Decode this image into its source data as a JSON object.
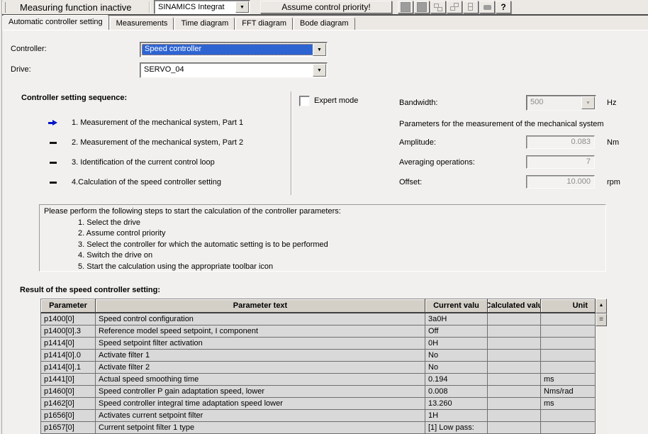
{
  "colors": {
    "highlight_blue": "#2d64d2",
    "arrow_blue": "#0016c8",
    "table_row_bg": "#d9d9d9"
  },
  "toolbar": {
    "status": "Measuring function inactive",
    "device_combo": "SINAMICS Integrat",
    "assume_button": "Assume control priority!",
    "icons": [
      {
        "name": "gray-square-icon"
      },
      {
        "name": "gray-square-icon"
      },
      {
        "name": "step-chain-icon"
      },
      {
        "name": "step-up-icon"
      },
      {
        "name": "step-branch-icon"
      },
      {
        "name": "solid-bar-icon"
      },
      {
        "name": "help-icon",
        "glyph": "?"
      }
    ]
  },
  "tabs": [
    {
      "label": "Automatic controller setting",
      "state": "active"
    },
    {
      "label": "Measurements"
    },
    {
      "label": "Time diagram"
    },
    {
      "label": "FFT diagram"
    },
    {
      "label": "Bode diagram"
    }
  ],
  "form": {
    "controller_label": "Controller:",
    "controller_value": "Speed controller",
    "drive_label": "Drive:",
    "drive_value": "SERVO_04"
  },
  "sequence": {
    "title": "Controller setting sequence:",
    "steps": [
      {
        "marker": "arrow",
        "text": "1. Measurement of the mechanical system, Part 1"
      },
      {
        "marker": "dash",
        "text": "2. Measurement of the mechanical system, Part 2"
      },
      {
        "marker": "dash",
        "text": "3. Identification of the current control loop"
      },
      {
        "marker": "dash",
        "text": "4.Calculation of the speed controller setting"
      }
    ]
  },
  "expert": {
    "checkbox_label": "Expert mode",
    "bandwidth_label": "Bandwidth:",
    "bandwidth_value": "500",
    "bandwidth_unit": "Hz",
    "params_heading": "Parameters for the measurement of the mechanical system",
    "amplitude_label": "Amplitude:",
    "amplitude_value": "0.083",
    "amplitude_unit": "Nm",
    "averaging_label": "Averaging operations:",
    "averaging_value": "7",
    "offset_label": "Offset:",
    "offset_value": "10.000",
    "offset_unit": "rpm"
  },
  "instructions": {
    "intro": "Please perform the following steps to start the calculation of the controller parameters:",
    "steps": [
      "1. Select the drive",
      "2. Assume control priority",
      "3. Select the controller for which the automatic setting is to be performed",
      "4. Switch the drive on",
      "5. Start the calculation using the appropriate toolbar icon"
    ]
  },
  "result": {
    "title": "Result of the speed controller setting:",
    "columns": [
      "Parameter",
      "Parameter text",
      "Current valu",
      "Calculated valu",
      "Unit"
    ],
    "rows": [
      {
        "param": "p1400[0]",
        "text": "Speed control configuration",
        "current": "3a0H",
        "calc": "",
        "unit": ""
      },
      {
        "param": "p1400[0].3",
        "text": "Reference model speed setpoint, I component",
        "current": "Off",
        "calc": "",
        "unit": ""
      },
      {
        "param": "p1414[0]",
        "text": "Speed setpoint filter activation",
        "current": "0H",
        "calc": "",
        "unit": ""
      },
      {
        "param": "p1414[0].0",
        "text": "Activate filter 1",
        "current": "No",
        "calc": "",
        "unit": ""
      },
      {
        "param": "p1414[0].1",
        "text": "Activate filter 2",
        "current": "No",
        "calc": "",
        "unit": ""
      },
      {
        "param": "p1441[0]",
        "text": "Actual speed smoothing time",
        "current": "0.194",
        "calc": "",
        "unit": "ms"
      },
      {
        "param": "p1460[0]",
        "text": "Speed controller P gain adaptation speed, lower",
        "current": "0.008",
        "calc": "",
        "unit": "Nms/rad"
      },
      {
        "param": "p1462[0]",
        "text": "Speed controller integral time adaptation speed lower",
        "current": "13.260",
        "calc": "",
        "unit": "ms"
      },
      {
        "param": "p1656[0]",
        "text": "Activates current setpoint filter",
        "current": "1H",
        "calc": "",
        "unit": ""
      },
      {
        "param": "p1657[0]",
        "text": "Current setpoint filter 1 type",
        "current": "[1] Low pass:",
        "calc": "",
        "unit": ""
      }
    ]
  }
}
